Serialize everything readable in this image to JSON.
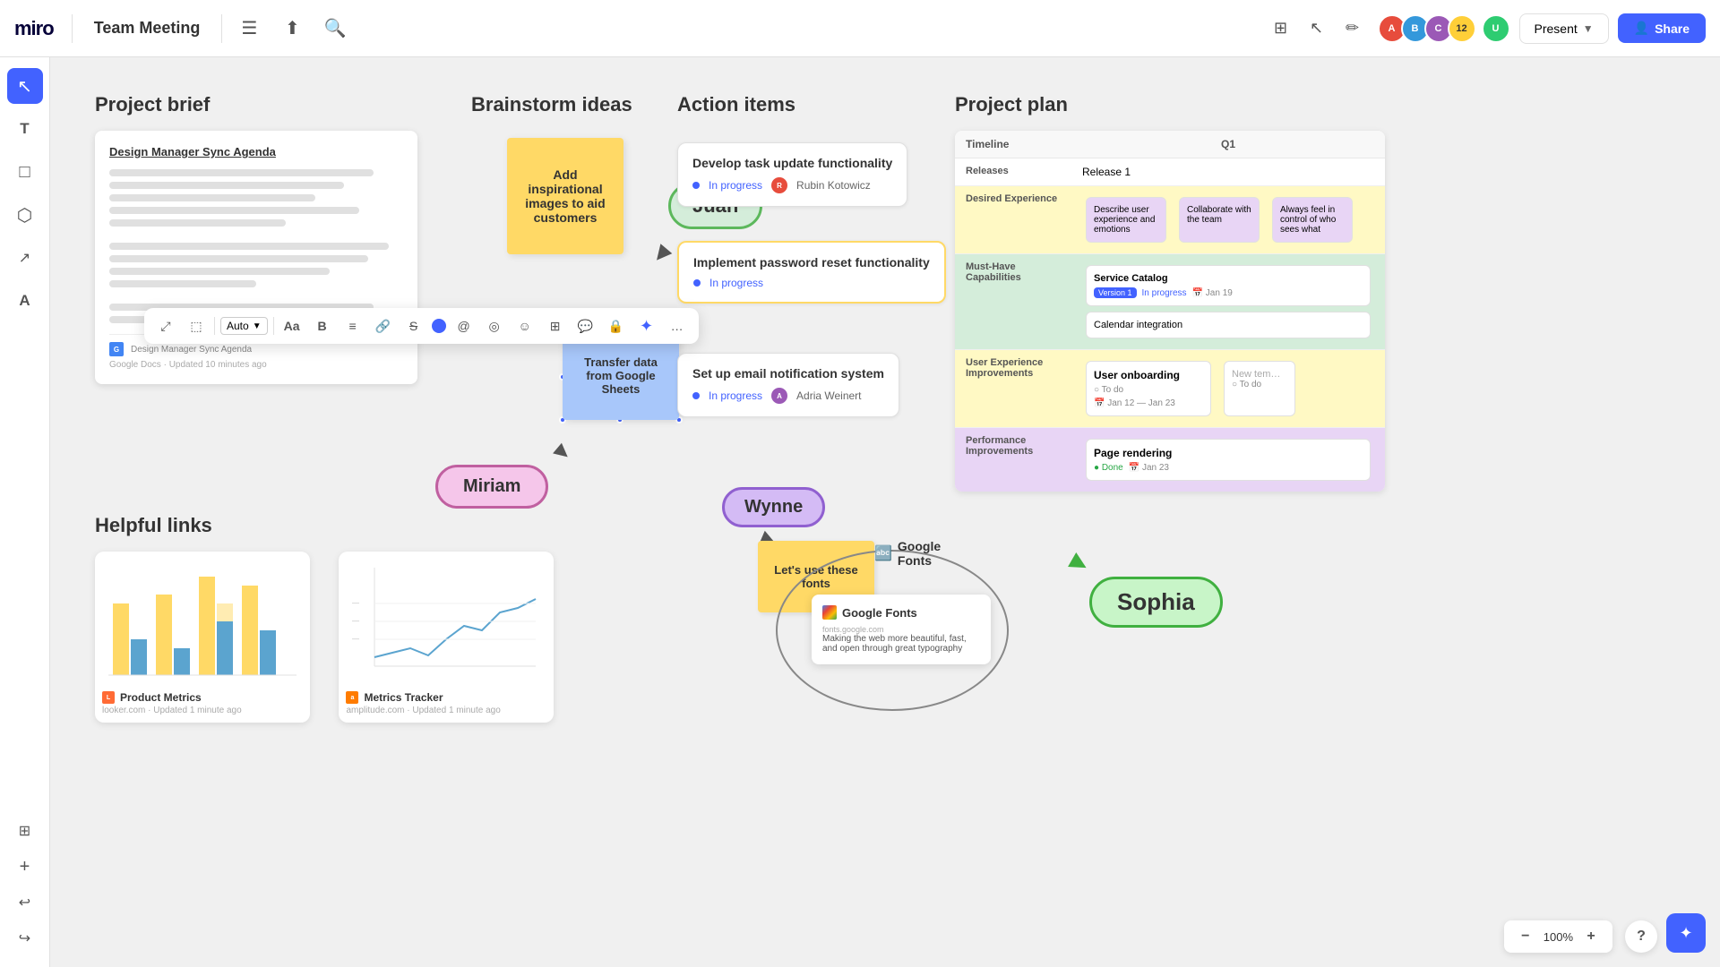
{
  "app": {
    "logo": "miro",
    "board_title": "Team Meeting"
  },
  "topbar": {
    "menu_icon": "☰",
    "upload_icon": "⬆",
    "search_icon": "🔍",
    "present_label": "Present",
    "share_label": "Share",
    "avatar_count": "12",
    "toolbar_icons": [
      "🎯",
      "↖",
      "✏"
    ]
  },
  "left_sidebar": {
    "tools": [
      {
        "name": "select",
        "icon": "↖",
        "active": true
      },
      {
        "name": "text",
        "icon": "T"
      },
      {
        "name": "note",
        "icon": "🗒"
      },
      {
        "name": "shapes",
        "icon": "◱"
      },
      {
        "name": "pen",
        "icon": "✒"
      },
      {
        "name": "eraser",
        "icon": "A"
      },
      {
        "name": "panels",
        "icon": "⊞"
      }
    ]
  },
  "project_brief": {
    "section_label": "Project brief",
    "card_title": "Design Manager Sync Agenda",
    "footer_doc": "Design Manager Sync Agenda",
    "footer_source": "Google Docs",
    "footer_updated": "Updated 10 minutes ago"
  },
  "brainstorm": {
    "section_label": "Brainstorm ideas",
    "sticky_text": "Add inspirational images to aid customers",
    "blue_sticky": "Transfer data from Google Sheets",
    "juan_label": "Juan",
    "miriam_label": "Miriam"
  },
  "action_items": {
    "section_label": "Action items",
    "cards": [
      {
        "title": "Develop task update functionality",
        "status": "In progress",
        "assignee": "Rubin Kotowicz",
        "border": "normal"
      },
      {
        "title": "Implement password reset functionality",
        "status": "In progress",
        "assignee": "",
        "border": "yellow"
      },
      {
        "title": "Set up email notification system",
        "status": "In progress",
        "assignee": "Adria Weinert",
        "border": "normal"
      }
    ]
  },
  "helpful_links": {
    "section_label": "Helpful links",
    "links": [
      {
        "title": "Product Metrics",
        "source": "looker.com",
        "updated": "Updated 1 minute ago"
      },
      {
        "title": "Metrics Tracker",
        "source": "amplitude.com",
        "updated": "Updated 1 minute ago"
      }
    ]
  },
  "google_fonts": {
    "wynne_label": "Wynne",
    "sticky_text": "Let's use these fonts",
    "brand_name": "Google Fonts",
    "card_title": "Google Fonts",
    "card_url": "fonts.google.com",
    "card_desc": "Making the web more beautiful, fast, and open through great typography"
  },
  "project_plan": {
    "section_label": "Project plan",
    "col_timeline": "Timeline",
    "col_q1": "Q1",
    "rows": [
      {
        "label": "Releases",
        "content": "Release 1",
        "color": "white"
      },
      {
        "label": "Desired Experience",
        "items": [
          "Describe user experience and emotions",
          "Collaborate with the team",
          "Always feel in control of who sees what"
        ],
        "color": "yellow"
      },
      {
        "label": "Must-Have Capabilities",
        "items": [
          {
            "name": "Service Catalog",
            "badge": "Version 1",
            "status": "In progress",
            "date": "Jan 19"
          },
          {
            "name": "Calendar integration"
          }
        ],
        "color": "green"
      },
      {
        "label": "User Experience Improvements",
        "items": [
          {
            "name": "User onboarding",
            "status": "To do",
            "date_range": "Jan 12 — Jan 23"
          },
          {
            "name": "New tem...",
            "status": "To do"
          }
        ],
        "color": "yellow"
      },
      {
        "label": "Performance Improvements",
        "items": [
          {
            "name": "Page rendering",
            "status": "Done",
            "date": "Jan 23"
          }
        ],
        "color": "purple"
      }
    ]
  },
  "sophia": {
    "label": "Sophia"
  },
  "zoom": {
    "level": "100%",
    "minus_icon": "−",
    "plus_icon": "+"
  },
  "floating_toolbar": {
    "auto_label": "Auto",
    "font_icon": "Aa",
    "bold_icon": "B",
    "align_icon": "≡",
    "link_icon": "🔗",
    "strike_icon": "S",
    "tag_icon": "◎",
    "label_icon": "⬡",
    "emoji_icon": "☺",
    "table_icon": "⊞",
    "comment_icon": "💬",
    "lock_icon": "🔒",
    "ai_icon": "✦",
    "more_icon": "…"
  }
}
